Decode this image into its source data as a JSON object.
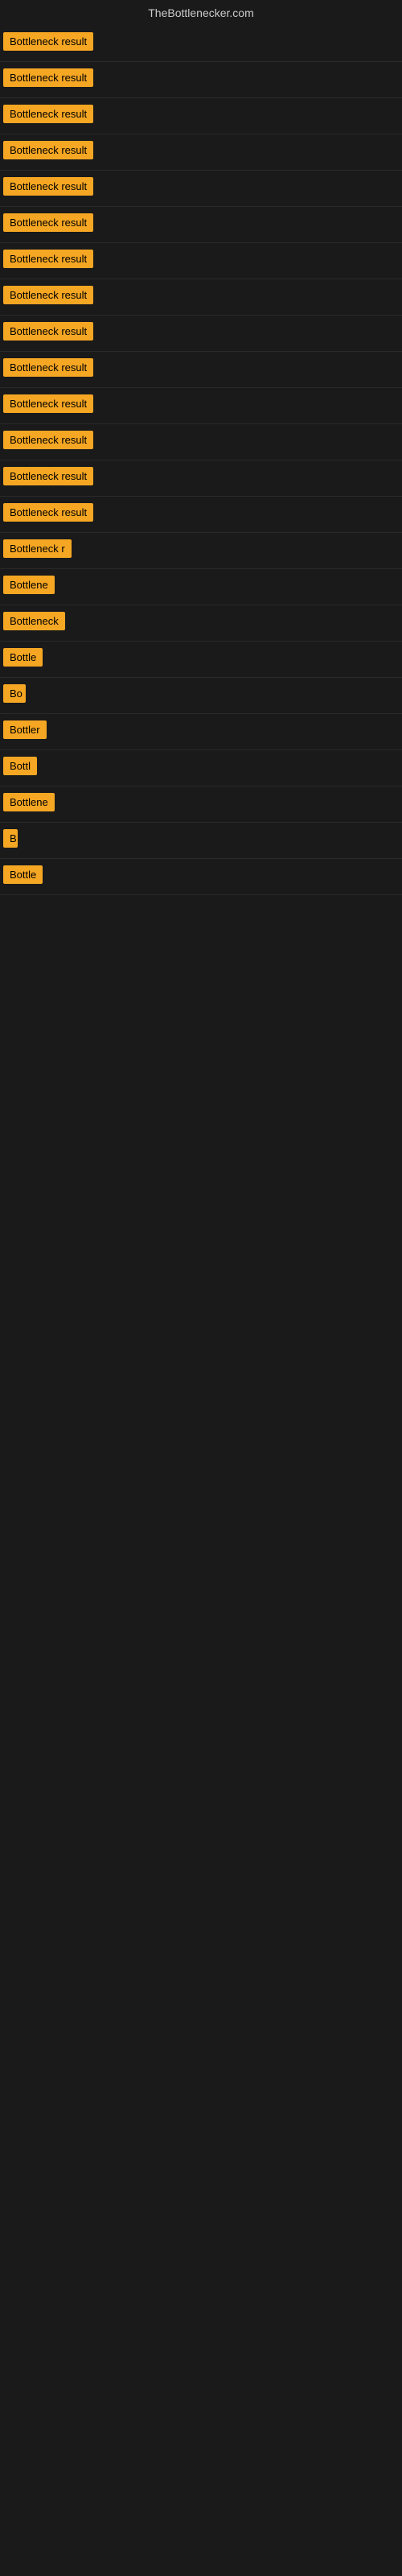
{
  "site": {
    "title": "TheBottlenecker.com"
  },
  "results": [
    {
      "id": 1,
      "label": "Bottleneck result",
      "width": 135
    },
    {
      "id": 2,
      "label": "Bottleneck result",
      "width": 135
    },
    {
      "id": 3,
      "label": "Bottleneck result",
      "width": 135
    },
    {
      "id": 4,
      "label": "Bottleneck result",
      "width": 135
    },
    {
      "id": 5,
      "label": "Bottleneck result",
      "width": 135
    },
    {
      "id": 6,
      "label": "Bottleneck result",
      "width": 135
    },
    {
      "id": 7,
      "label": "Bottleneck result",
      "width": 135
    },
    {
      "id": 8,
      "label": "Bottleneck result",
      "width": 135
    },
    {
      "id": 9,
      "label": "Bottleneck result",
      "width": 135
    },
    {
      "id": 10,
      "label": "Bottleneck result",
      "width": 135
    },
    {
      "id": 11,
      "label": "Bottleneck result",
      "width": 135
    },
    {
      "id": 12,
      "label": "Bottleneck result",
      "width": 130
    },
    {
      "id": 13,
      "label": "Bottleneck result",
      "width": 130
    },
    {
      "id": 14,
      "label": "Bottleneck result",
      "width": 120
    },
    {
      "id": 15,
      "label": "Bottleneck r",
      "width": 90
    },
    {
      "id": 16,
      "label": "Bottlene",
      "width": 72
    },
    {
      "id": 17,
      "label": "Bottleneck",
      "width": 80
    },
    {
      "id": 18,
      "label": "Bottle",
      "width": 58
    },
    {
      "id": 19,
      "label": "Bo",
      "width": 28
    },
    {
      "id": 20,
      "label": "Bottler",
      "width": 62
    },
    {
      "id": 21,
      "label": "Bottl",
      "width": 50
    },
    {
      "id": 22,
      "label": "Bottlene",
      "width": 68
    },
    {
      "id": 23,
      "label": "B",
      "width": 18
    },
    {
      "id": 24,
      "label": "Bottle",
      "width": 58
    }
  ]
}
